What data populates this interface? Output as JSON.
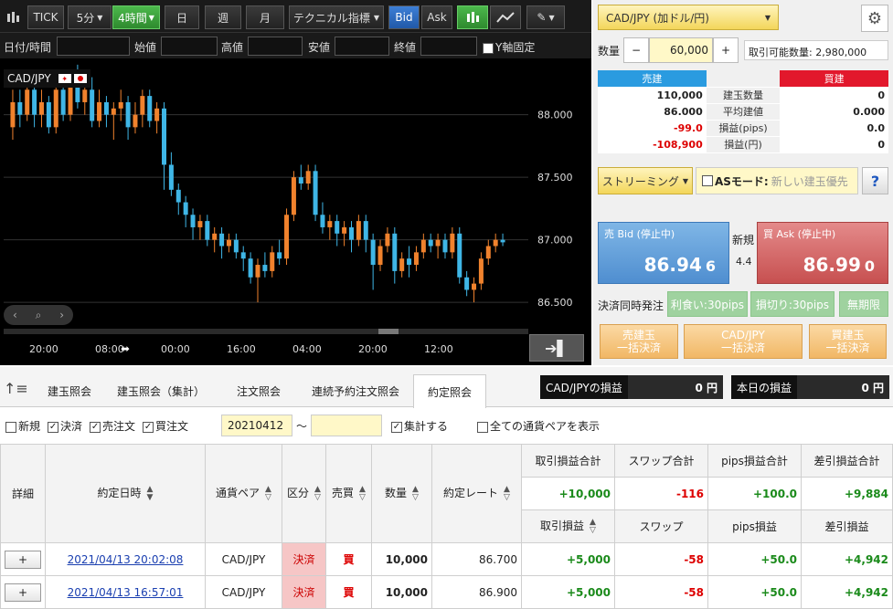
{
  "toolbar": {
    "tick": "TICK",
    "m5": "5分",
    "h4": "4時間",
    "day": "日",
    "week": "週",
    "month": "月",
    "tech": "テクニカル指標",
    "bid": "Bid",
    "ask": "Ask"
  },
  "ohlc": {
    "datetime": "日付/時間",
    "open": "始値",
    "high": "高値",
    "low": "安値",
    "close": "終値",
    "yfix": "Y軸固定"
  },
  "chart": {
    "pair": "CAD/JPY",
    "yticks": [
      "88.000",
      "87.500",
      "87.000",
      "86.500"
    ],
    "xticks": [
      "20:00",
      "08:00",
      "00:00",
      "16:00",
      "04:00",
      "20:00",
      "12:00"
    ]
  },
  "chart_data": {
    "type": "candlestick",
    "yrange": [
      86.45,
      88.45
    ],
    "candles": [
      [
        87.9,
        88.1,
        87.8,
        88.2
      ],
      [
        88.1,
        88.0,
        87.9,
        88.2
      ],
      [
        88.0,
        88.2,
        87.95,
        88.3
      ],
      [
        88.2,
        88.0,
        87.9,
        88.25
      ],
      [
        88.0,
        88.1,
        87.9,
        88.2
      ],
      [
        88.1,
        87.9,
        87.85,
        88.15
      ],
      [
        87.9,
        88.2,
        87.85,
        88.3
      ],
      [
        88.2,
        88.0,
        87.95,
        88.25
      ],
      [
        88.0,
        88.3,
        87.95,
        88.35
      ],
      [
        88.3,
        88.1,
        88.05,
        88.4
      ],
      [
        88.1,
        88.2,
        88.0,
        88.3
      ],
      [
        88.2,
        87.95,
        87.9,
        88.3
      ],
      [
        87.95,
        88.1,
        87.9,
        88.2
      ],
      [
        88.1,
        88.0,
        87.9,
        88.15
      ],
      [
        88.0,
        88.05,
        87.8,
        88.1
      ],
      [
        88.05,
        88.1,
        87.95,
        88.2
      ],
      [
        88.1,
        87.9,
        87.8,
        88.15
      ],
      [
        87.9,
        88.0,
        87.85,
        88.1
      ],
      [
        88.0,
        88.15,
        87.9,
        88.2
      ],
      [
        88.15,
        87.95,
        87.9,
        88.2
      ],
      [
        87.95,
        88.05,
        87.85,
        88.1
      ],
      [
        88.05,
        87.6,
        87.4,
        88.1
      ],
      [
        87.6,
        87.4,
        87.35,
        87.7
      ],
      [
        87.4,
        87.3,
        87.2,
        87.45
      ],
      [
        87.3,
        87.2,
        87.1,
        87.35
      ],
      [
        87.2,
        87.1,
        87.0,
        87.25
      ],
      [
        87.1,
        87.15,
        87.0,
        87.2
      ],
      [
        87.15,
        87.0,
        86.95,
        87.2
      ],
      [
        87.0,
        87.05,
        86.9,
        87.1
      ],
      [
        87.05,
        86.95,
        86.85,
        87.1
      ],
      [
        86.95,
        87.0,
        86.9,
        87.05
      ],
      [
        87.0,
        86.9,
        86.85,
        87.05
      ],
      [
        86.9,
        86.85,
        86.75,
        86.95
      ],
      [
        86.85,
        86.7,
        86.65,
        86.9
      ],
      [
        86.7,
        86.8,
        86.5,
        86.85
      ],
      [
        86.8,
        86.75,
        86.7,
        86.9
      ],
      [
        86.75,
        86.9,
        86.7,
        86.95
      ],
      [
        86.9,
        86.85,
        86.8,
        87.0
      ],
      [
        86.85,
        87.2,
        86.8,
        87.25
      ],
      [
        87.2,
        87.5,
        87.15,
        87.55
      ],
      [
        87.5,
        87.45,
        87.4,
        87.6
      ],
      [
        87.45,
        87.55,
        87.4,
        87.6
      ],
      [
        87.55,
        87.2,
        87.15,
        87.6
      ],
      [
        87.2,
        87.1,
        87.05,
        87.3
      ],
      [
        87.1,
        87.15,
        87.0,
        87.2
      ],
      [
        87.15,
        87.05,
        86.95,
        87.2
      ],
      [
        87.05,
        87.1,
        86.95,
        87.15
      ],
      [
        87.1,
        87.0,
        86.9,
        87.15
      ],
      [
        87.0,
        87.15,
        86.95,
        87.2
      ],
      [
        87.15,
        87.0,
        86.9,
        87.2
      ],
      [
        87.0,
        86.8,
        86.6,
        87.05
      ],
      [
        86.8,
        86.95,
        86.75,
        87.0
      ],
      [
        86.95,
        87.05,
        86.9,
        87.1
      ],
      [
        87.05,
        86.75,
        86.65,
        87.1
      ],
      [
        86.75,
        86.85,
        86.7,
        86.9
      ],
      [
        86.85,
        86.8,
        86.7,
        86.95
      ],
      [
        86.8,
        86.9,
        86.75,
        86.95
      ],
      [
        86.9,
        87.0,
        86.85,
        87.05
      ],
      [
        87.0,
        86.95,
        86.9,
        87.05
      ],
      [
        86.95,
        87.0,
        86.85,
        87.05
      ],
      [
        87.0,
        86.9,
        86.85,
        87.05
      ],
      [
        86.9,
        87.05,
        86.85,
        87.1
      ],
      [
        87.05,
        86.7,
        86.65,
        87.1
      ],
      [
        86.7,
        86.6,
        86.55,
        86.75
      ],
      [
        86.6,
        86.65,
        86.5,
        86.7
      ],
      [
        86.65,
        86.85,
        86.6,
        86.9
      ],
      [
        86.85,
        86.95,
        86.8,
        87.0
      ],
      [
        86.95,
        87.0,
        86.9,
        87.05
      ],
      [
        87.0,
        86.98,
        86.95,
        87.05
      ]
    ]
  },
  "right": {
    "pair_select": "CAD/JPY (加ドル/円)",
    "qty_label": "数量",
    "minus": "−",
    "qty": "60,000",
    "plus": "+",
    "avail": "取引可能数量: 2,980,000",
    "sell_head": "売建",
    "buy_head": "買建",
    "rows": [
      {
        "l": "110,000",
        "m": "建玉数量",
        "r": "0"
      },
      {
        "l": "86.000",
        "m": "平均建値",
        "r": "0.000"
      },
      {
        "l": "-99.0",
        "m": "損益(pips)",
        "r": "0.0"
      },
      {
        "l": "-108,900",
        "m": "損益(円)",
        "r": "0"
      }
    ],
    "streaming": "ストリーミング",
    "as_mode": "ASモード:",
    "as_hint": "新しい建玉優先",
    "help": "?",
    "bid_label": "売 Bid (停止中)",
    "bid_big": "86.94",
    "bid_small": "6",
    "new_label": "新規",
    "spread": "4.4",
    "ask_label": "買 Ask (停止中)",
    "ask_big": "86.99",
    "ask_small": "0",
    "settle_label": "決済同時発注",
    "take": "利食い:30pips",
    "stop": "損切り:30pips",
    "expiry": "無期限",
    "b1a": "売建玉",
    "b1b": "一括決済",
    "b2a": "CAD/JPY",
    "b2b": "一括決済",
    "b3a": "買建玉",
    "b3b": "一括決済"
  },
  "tabs": [
    "建玉照会",
    "建玉照会（集計）",
    "注文照会",
    "連続予約注文照会",
    "約定照会"
  ],
  "pnl": {
    "pair_label": "CAD/JPYの損益",
    "pair_val": "0 円",
    "today_label": "本日の損益",
    "today_val": "0 円"
  },
  "filters": {
    "new": "新規",
    "settle": "決済",
    "sell": "売注文",
    "buy": "買注文",
    "from": "20210412",
    "tilde": "〜",
    "aggregate": "集計する",
    "all_pairs": "全ての通貨ペアを表示"
  },
  "table": {
    "h_detail": "詳細",
    "h_date": "約定日時",
    "h_pair": "通貨ペア",
    "h_type": "区分",
    "h_side": "売買",
    "h_qty": "数量",
    "h_rate": "約定レート",
    "h_pl_total": "取引損益合計",
    "h_swap_total": "スワップ合計",
    "h_pips_total": "pips損益合計",
    "h_net_total": "差引損益合計",
    "t_pl": "+10,000",
    "t_swap": "-116",
    "t_pips": "+100.0",
    "t_net": "+9,884",
    "h_pl": "取引損益",
    "h_swap": "スワップ",
    "h_pips": "pips損益",
    "h_net": "差引損益",
    "rows": [
      {
        "plus": "+",
        "date": "2021/04/13 20:02:08",
        "pair": "CAD/JPY",
        "type": "決済",
        "side": "買",
        "qty": "10,000",
        "rate": "86.700",
        "pl": "+5,000",
        "swap": "-58",
        "pips": "+50.0",
        "net": "+4,942"
      },
      {
        "plus": "+",
        "date": "2021/04/13 16:57:01",
        "pair": "CAD/JPY",
        "type": "決済",
        "side": "買",
        "qty": "10,000",
        "rate": "86.900",
        "pl": "+5,000",
        "swap": "-58",
        "pips": "+50.0",
        "net": "+4,942"
      }
    ]
  }
}
